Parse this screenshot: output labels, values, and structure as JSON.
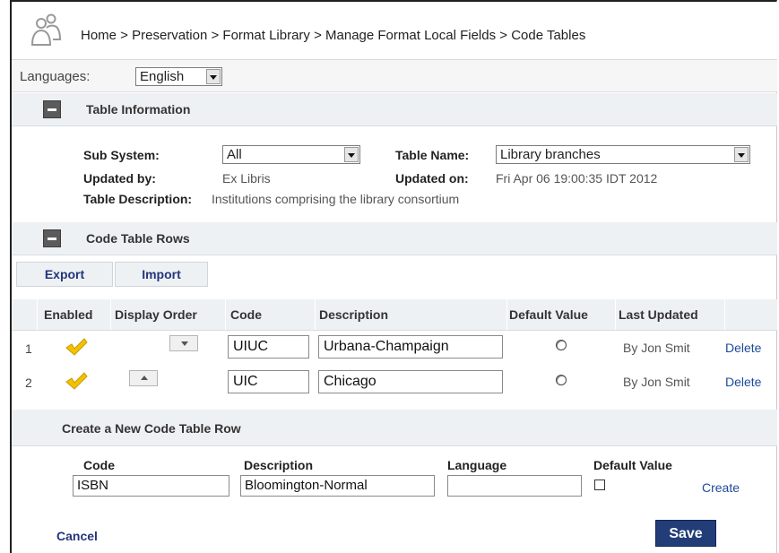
{
  "breadcrumb": "Home > Preservation > Format Library > Manage Format Local Fields > Code Tables",
  "languages": {
    "label": "Languages:",
    "value": "English"
  },
  "table_information": {
    "title": "Table Information",
    "sub_system_label": "Sub System:",
    "sub_system_value": "All",
    "table_name_label": "Table Name:",
    "table_name_value": "Library branches",
    "updated_by_label": "Updated by:",
    "updated_by_value": "Ex Libris",
    "updated_on_label": "Updated on:",
    "updated_on_value": "Fri Apr 06 19:00:35 IDT 2012",
    "description_label": "Table Description:",
    "description_value": "Institutions comprising the library consortium"
  },
  "code_table_rows": {
    "title": "Code Table Rows",
    "export_label": "Export",
    "import_label": "Import",
    "columns": [
      "Enabled",
      "Display Order",
      "Code",
      "Description",
      "Default Value",
      "Last Updated"
    ],
    "rows": [
      {
        "num": "1",
        "code": "UIUC",
        "description": "Urbana-Champaign",
        "last_updated": "By Jon Smit",
        "delete_label": "Delete"
      },
      {
        "num": "2",
        "code": "UIC",
        "description": "Chicago",
        "last_updated": "By Jon Smit",
        "delete_label": "Delete"
      }
    ]
  },
  "create_row": {
    "title": "Create a New Code Table Row",
    "code_label": "Code",
    "code_value": "ISBN",
    "description_label": "Description",
    "description_value": "Bloomington-Normal",
    "language_label": "Language",
    "language_value": "",
    "default_label": "Default Value",
    "create_label": "Create"
  },
  "footer": {
    "cancel_label": "Cancel",
    "save_label": "Save"
  },
  "colors": {
    "accent": "#223d78",
    "link": "#1d4a9a",
    "section_bg": "#eef1f4",
    "check": "#f2c200"
  }
}
